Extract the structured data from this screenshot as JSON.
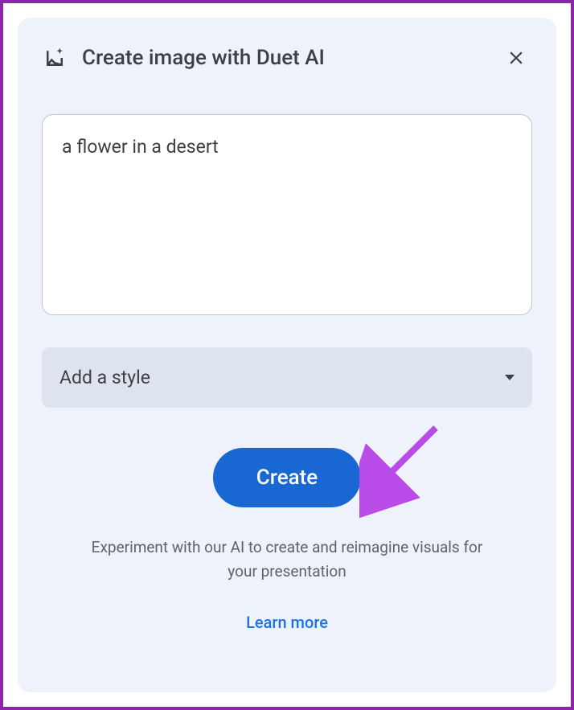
{
  "header": {
    "title": "Create image with Duet AI"
  },
  "prompt": {
    "value": "a flower in a desert"
  },
  "dropdown": {
    "label": "Add a style"
  },
  "actions": {
    "create_label": "Create"
  },
  "footer": {
    "info_text": "Experiment with our AI to create and reimagine visuals for your presentation",
    "learn_more_label": "Learn more"
  }
}
